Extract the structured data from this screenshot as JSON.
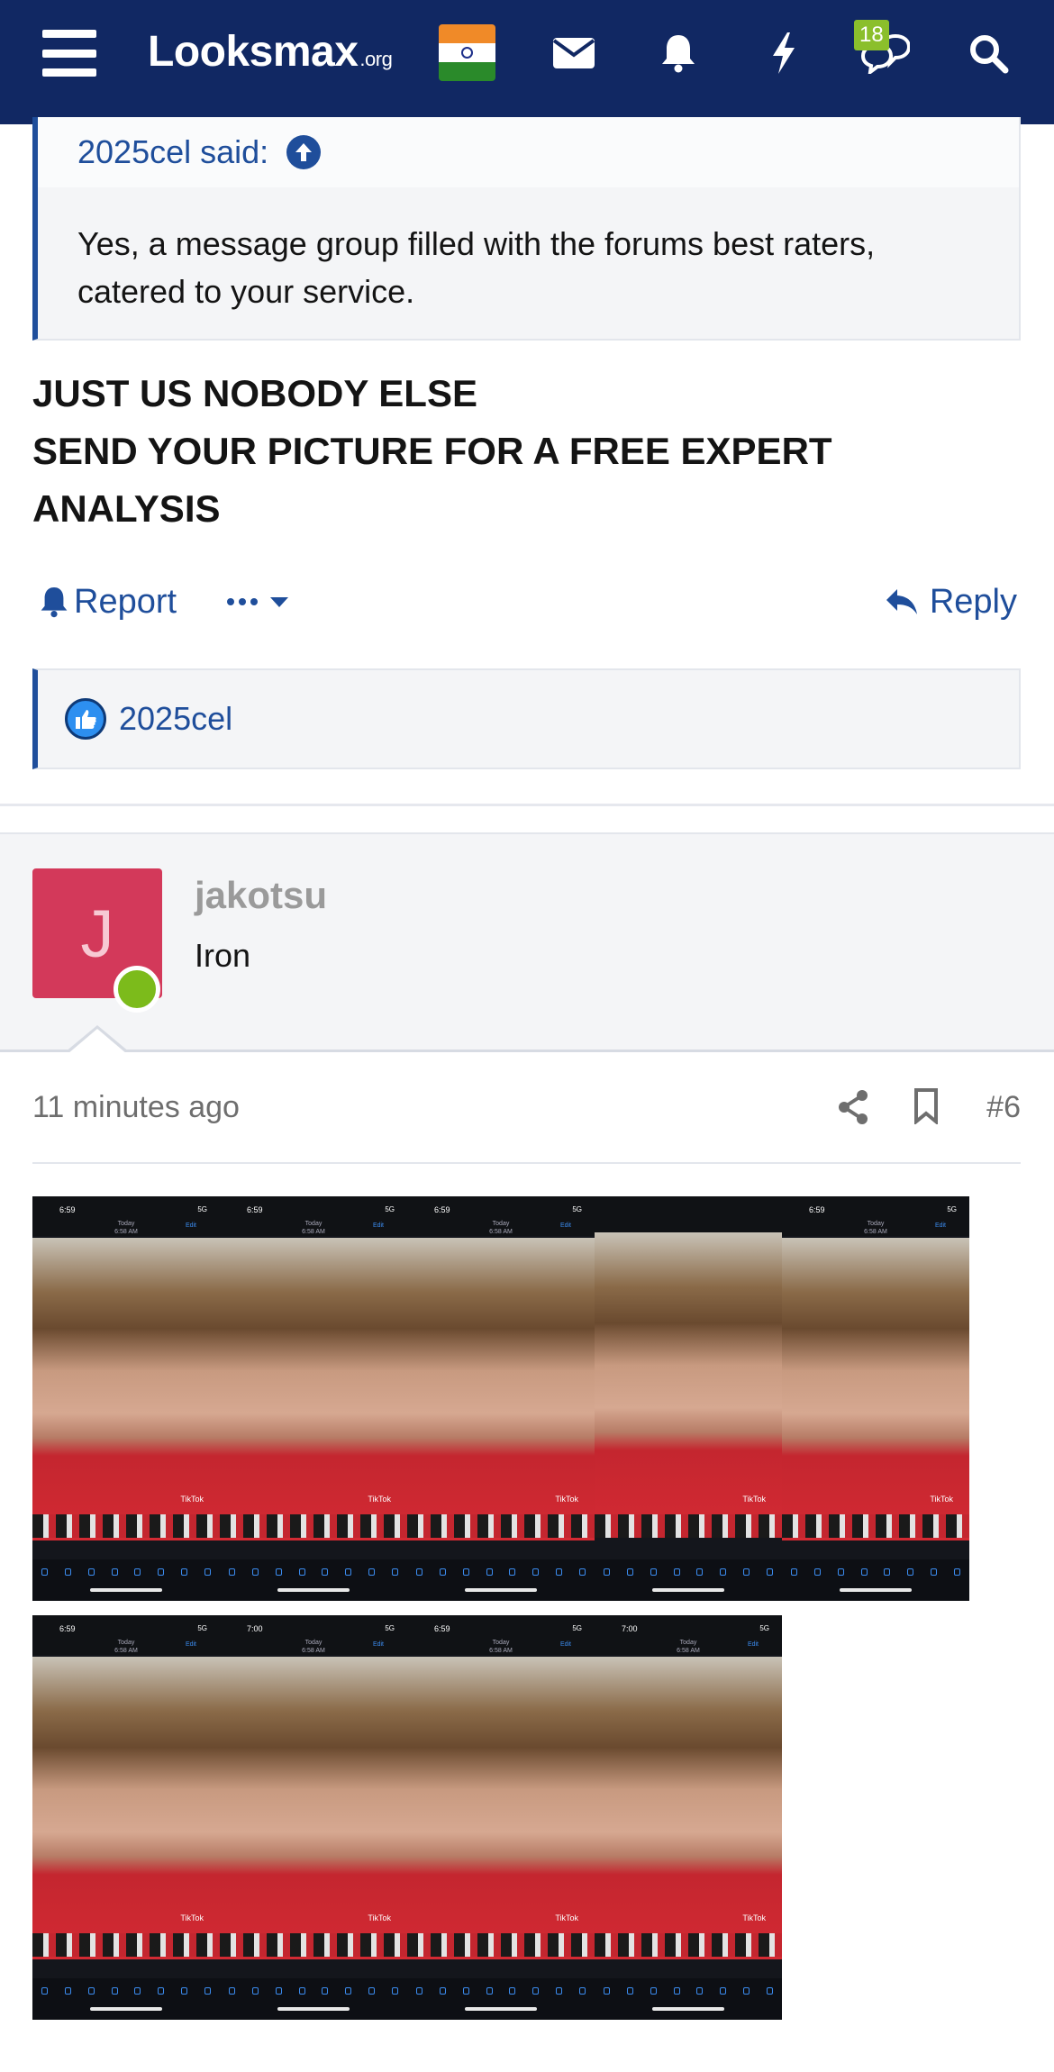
{
  "navbar": {
    "logo_main": "Looksmax",
    "logo_suffix": ".org",
    "conversations_badge": "18",
    "icons": [
      "menu-icon",
      "india-flag-icon",
      "envelope-icon",
      "bell-icon",
      "lightning-icon",
      "chat-bubbles-icon",
      "search-icon"
    ],
    "background_color": "#112863"
  },
  "quote": {
    "author_said": "2025cel said:",
    "text": "Yes, a message group filled with the forums best raters, catered to your service."
  },
  "post": {
    "line1": "JUST US NOBODY ELSE",
    "line2": "SEND YOUR PICTURE FOR A FREE EXPERT ANALYSIS"
  },
  "actions": {
    "report": "Report",
    "reply": "Reply"
  },
  "reactions": {
    "user": "2025cel"
  },
  "next_post": {
    "avatar_letter": "J",
    "username": "jakotsu",
    "user_title": "Iron",
    "time": "11 minutes ago",
    "post_number": "#6",
    "avatar_color": "#d3395a",
    "online_color": "#7cbb1b"
  },
  "attachments": {
    "tiles": [
      {
        "time": "6:59",
        "carrier": "5G",
        "header": "Today",
        "header_sub": "6:58 AM",
        "edit": "Edit",
        "watermark": "TikTok"
      },
      {
        "time": "6:59",
        "carrier": "5G",
        "header": "Today",
        "header_sub": "6:58 AM",
        "edit": "Edit",
        "watermark": "TikTok"
      },
      {
        "time": "6:59",
        "carrier": "5G",
        "header": "Today",
        "header_sub": "6:58 AM",
        "edit": "Edit",
        "watermark": "TikTok"
      },
      {
        "time": "",
        "carrier": "",
        "header": "",
        "header_sub": "",
        "edit": "",
        "watermark": "TikTok"
      },
      {
        "time": "6:59",
        "carrier": "5G",
        "header": "Today",
        "header_sub": "6:58 AM",
        "edit": "Edit",
        "watermark": "TikTok"
      },
      {
        "time": "6:59",
        "carrier": "5G",
        "header": "Today",
        "header_sub": "6:58 AM",
        "edit": "Edit",
        "watermark": "TikTok"
      },
      {
        "time": "7:00",
        "carrier": "5G",
        "header": "Today",
        "header_sub": "6:58 AM",
        "edit": "Edit",
        "watermark": "TikTok"
      },
      {
        "time": "6:59",
        "carrier": "5G",
        "header": "Today",
        "header_sub": "6:58 AM",
        "edit": "Edit",
        "watermark": "TikTok"
      },
      {
        "time": "7:00",
        "carrier": "5G",
        "header": "Today",
        "header_sub": "6:58 AM",
        "edit": "Edit",
        "watermark": "TikTok"
      }
    ]
  }
}
